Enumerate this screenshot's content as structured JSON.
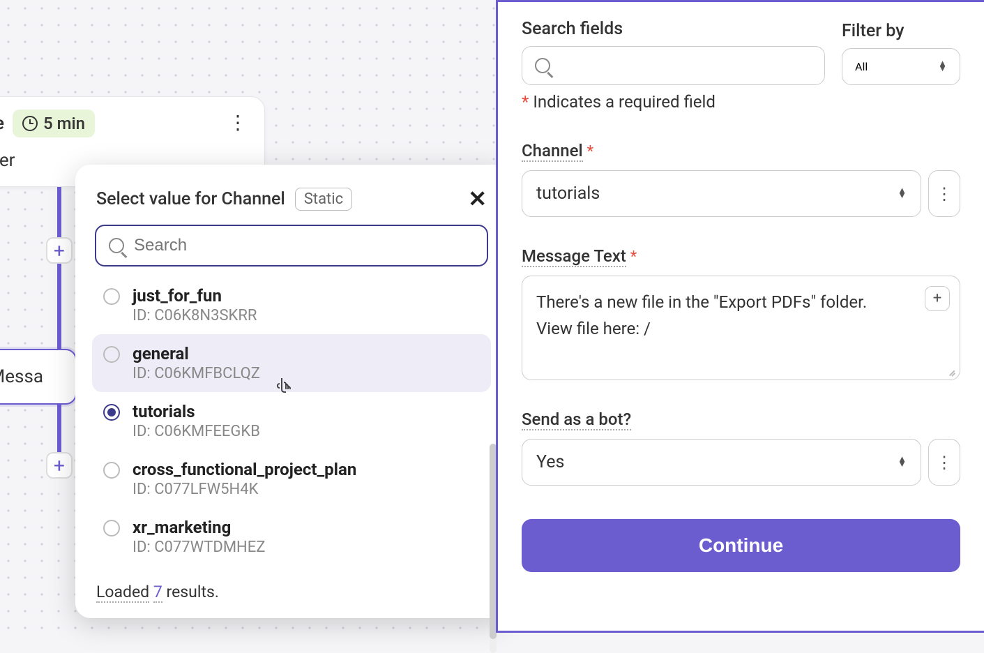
{
  "trigger": {
    "source_suffix": "rive",
    "interval": "5 min",
    "subtitle_suffix": "older"
  },
  "action_node": {
    "label_suffix": "el Messa"
  },
  "popover": {
    "title": "Select value for Channel",
    "mode_badge": "Static",
    "search_placeholder": "Search",
    "options": [
      {
        "name": "just_for_fun",
        "id": "ID: C06K8N3SKRR",
        "selected": false,
        "hover": false
      },
      {
        "name": "general",
        "id": "ID: C06KMFBCLQZ",
        "selected": false,
        "hover": true
      },
      {
        "name": "tutorials",
        "id": "ID: C06KMFEEGKB",
        "selected": true,
        "hover": false
      },
      {
        "name": "cross_functional_project_plan",
        "id": "ID: C077LFW5H4K",
        "selected": false,
        "hover": false
      },
      {
        "name": "xr_marketing",
        "id": "ID: C077WTDMHEZ",
        "selected": false,
        "hover": false
      }
    ],
    "footer_loaded": "Loaded",
    "footer_count": "7",
    "footer_results": "results."
  },
  "panel": {
    "search_label": "Search fields",
    "filter_label": "Filter by",
    "filter_value": "All",
    "required_note": "Indicates a required field",
    "channel": {
      "label": "Channel",
      "value": "tutorials"
    },
    "message": {
      "label": "Message Text",
      "line1": "There's a new file in the \"Export PDFs\" folder.",
      "line2": "View file here: /"
    },
    "bot": {
      "label": "Send as a bot?",
      "value": "Yes"
    },
    "continue": "Continue"
  }
}
